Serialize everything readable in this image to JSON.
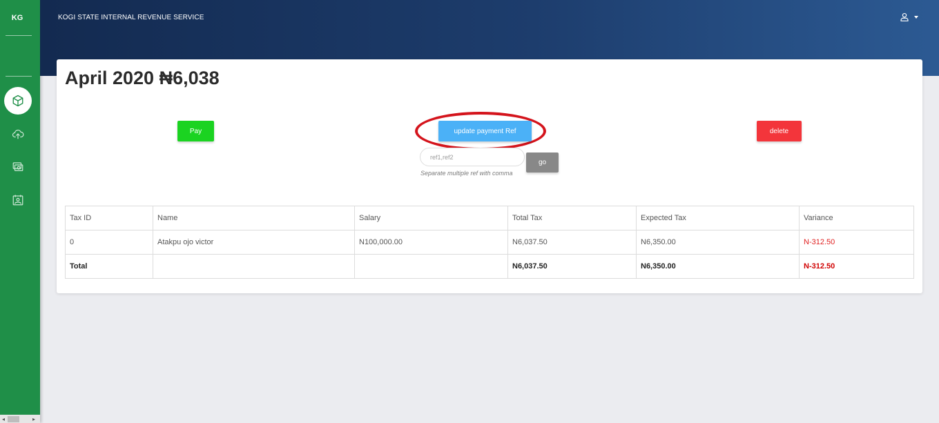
{
  "sidebar": {
    "brand": "KG",
    "items": [
      {
        "icon": "box-icon",
        "active": true
      },
      {
        "icon": "cloud-upload-icon",
        "active": false
      },
      {
        "icon": "money-icon",
        "active": false
      },
      {
        "icon": "photo-icon",
        "active": false
      }
    ]
  },
  "header": {
    "title": "KOGI STATE INTERNAL REVENUE SERVICE",
    "user_icon": "user-icon"
  },
  "page": {
    "title": "April 2020 ₦6,038"
  },
  "actions": {
    "pay_label": "Pay",
    "update_label": "update payment Ref",
    "delete_label": "delete",
    "go_label": "go",
    "ref_placeholder": "ref1,ref2",
    "ref_hint": "Separate multiple ref with comma"
  },
  "colors": {
    "sidebar": "#1f8f48",
    "pay": "#1bd321",
    "update": "#4bb1f7",
    "delete": "#f3353b",
    "go": "#888888",
    "variance": "#e02020",
    "highlight": "#d4141c"
  },
  "table": {
    "headers": [
      "Tax ID",
      "Name",
      "Salary",
      "Total Tax",
      "Expected Tax",
      "Variance"
    ],
    "rows": [
      [
        "0",
        "Atakpu ojo victor",
        "N100,000.00",
        "N6,037.50",
        "N6,350.00",
        "N-312.50"
      ]
    ],
    "total": [
      "Total",
      "",
      "",
      "N6,037.50",
      "N6,350.00",
      "N-312.50"
    ]
  }
}
